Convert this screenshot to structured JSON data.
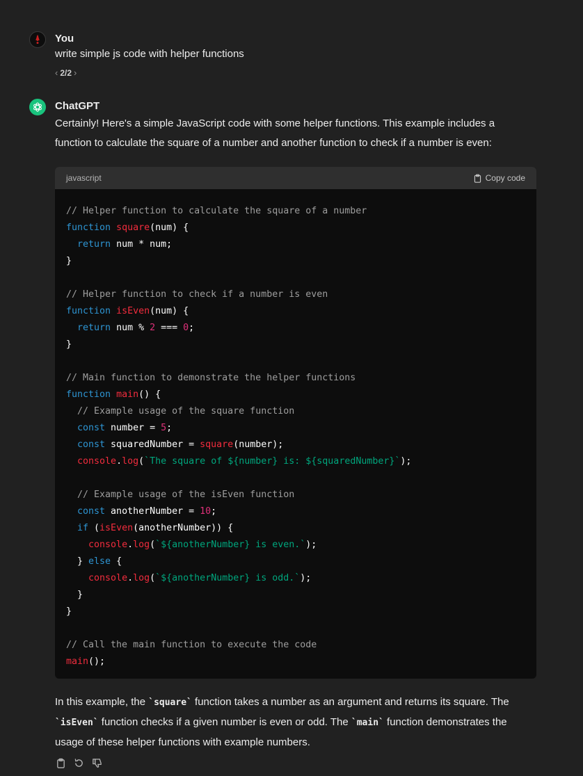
{
  "user_message": {
    "author": "You",
    "text": "write simple js code with helper functions",
    "pager": {
      "current": "2/2"
    }
  },
  "assistant_message": {
    "author": "ChatGPT",
    "intro_line1": "Certainly! Here's a simple JavaScript code with some helper functions. This example includes a",
    "intro_line2": "function to calculate the square of a number and another function to check if a number is even:",
    "code_block": {
      "language": "javascript",
      "copy_label": "Copy code"
    },
    "outro": {
      "p1": "In this example, the ",
      "c1": "`square`",
      "p2": " function takes a number as an argument and returns its square. The",
      "c2": "`isEven`",
      "p3": " function checks if a given number is even or odd. The ",
      "c3": "`main`",
      "p4": " function demonstrates the",
      "p5": "usage of these helper functions with example numbers."
    }
  },
  "colors": {
    "background": "#212121",
    "code_background": "#0d0d0d",
    "code_header": "#2f2f2f",
    "keyword": "#2e95d3",
    "function_name": "#f22c3d",
    "number": "#df3079",
    "string": "#00a67d",
    "comment": "#9e9e9e",
    "gpt_avatar": "#19c37d"
  },
  "icons": {
    "user_avatar": "alert-avatar-icon",
    "gpt_avatar": "openai-logo-icon",
    "copy": "clipboard-icon",
    "regenerate": "refresh-icon",
    "feedback": "thumbs-down-icon"
  }
}
